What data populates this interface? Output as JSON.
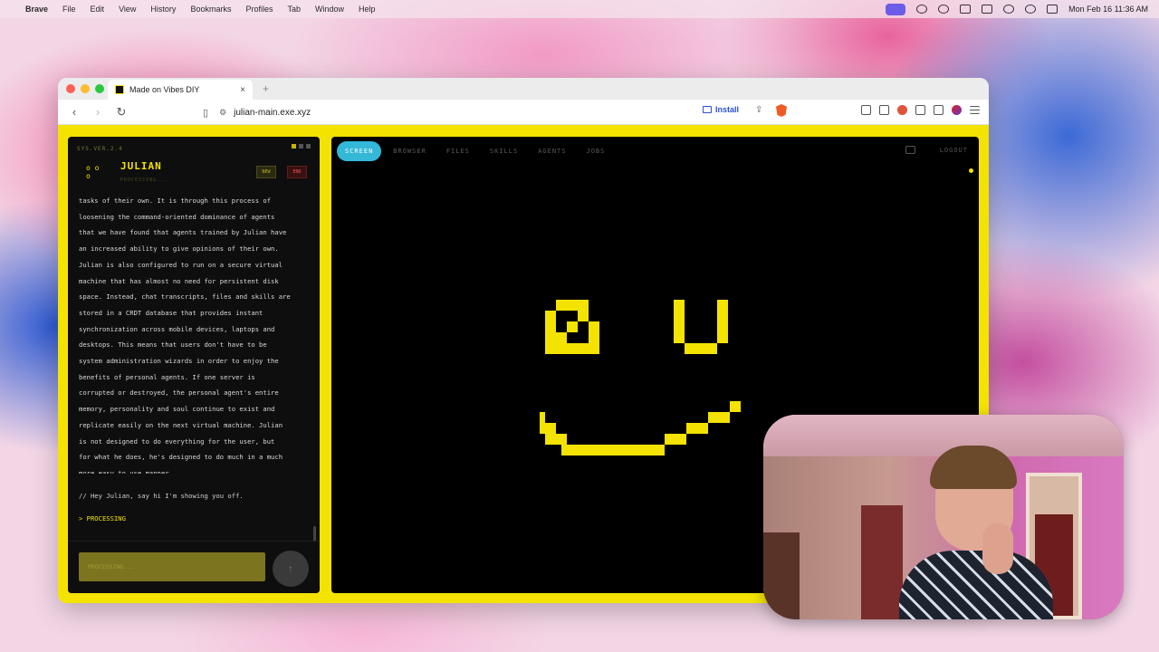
{
  "menubar": {
    "app": "Brave",
    "items": [
      "File",
      "Edit",
      "View",
      "History",
      "Bookmarks",
      "Profiles",
      "Tab",
      "Window",
      "Help"
    ],
    "clock": "Mon Feb 16 11:36 AM"
  },
  "browser": {
    "tab_title": "Made on Vibes DIY",
    "url": "julian-main.exe.xyz",
    "install_label": "Install"
  },
  "agent_panel": {
    "sys_version": "SYS.VER.2.4",
    "face": "o o\no",
    "name": "JULIAN",
    "status": "PROCESSING...",
    "new_label": "NEW",
    "end_label": "END",
    "transcript": [
      "tasks of their own. It is through this process of",
      "loosening the command-oriented dominance of agents",
      "that we have found that agents trained by Julian have",
      "an increased ability to give opinions of their own.",
      "Julian is also configured to run on a secure virtual",
      "machine that has almost no need for persistent disk",
      "space. Instead, chat transcripts, files and skills are",
      "stored in a CRDT database that provides instant",
      "synchronization across mobile devices, laptops and",
      "desktops. This means that users don't have to be",
      "system administration wizards in order to enjoy the",
      "benefits of personal agents. If one server is",
      "corrupted or destroyed, the personal agent's entire",
      "memory, personality and soul continue to exist and",
      "replicate easily on the next virtual machine. Julian",
      "is not designed to do everything for the user, but",
      "for what he does, he's designed to do much in a much",
      "more easy to use manner."
    ],
    "user_message": "// Hey Julian, say hi I'm showing you off.",
    "processing_line": "> PROCESSING",
    "input_placeholder": "PROCESSING..."
  },
  "screen_panel": {
    "tabs": [
      "SCREEN",
      "BROWSER",
      "FILES",
      "SKILLS",
      "AGENTS",
      "JOBS"
    ],
    "active_tab": "SCREEN",
    "logout_label": "LOGOUT"
  },
  "colors": {
    "accent_yellow": "#f4e300",
    "active_tab": "#33b8d8",
    "panel_bg": "#0e0e0e"
  },
  "icons": {
    "mb_record": "record-icon",
    "face": "pixel-smiley-face"
  }
}
